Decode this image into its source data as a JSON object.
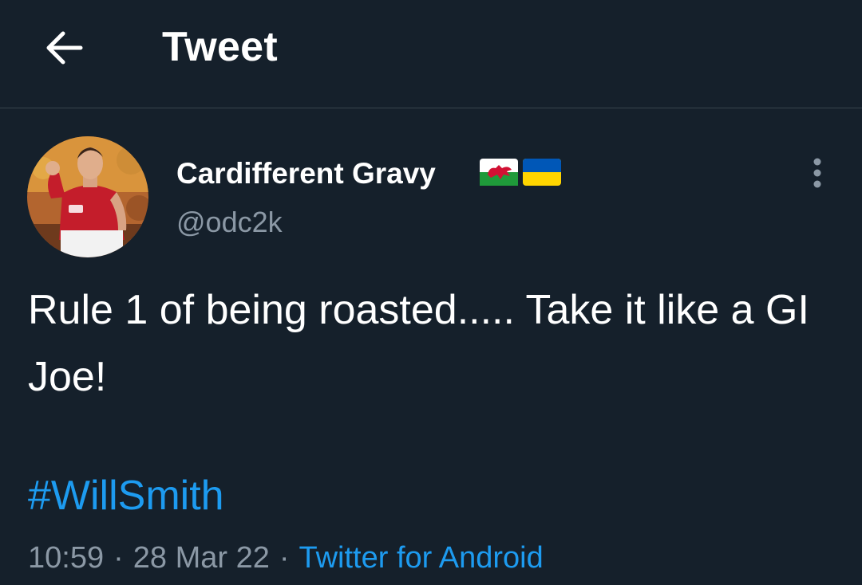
{
  "header": {
    "back_icon": "arrow-left-icon",
    "title": "Tweet"
  },
  "tweet": {
    "author": {
      "display_name": "Cardifferent Gravy",
      "handle": "@odc2k",
      "flags": [
        "wales-flag",
        "ukraine-flag"
      ]
    },
    "more_icon": "more-vertical-icon",
    "text": "Rule 1 of being roasted..... Take it like a GI Joe!",
    "hashtag": "#WillSmith",
    "time": "10:59",
    "separator": "·",
    "date": "28 Mar 22",
    "source": "Twitter for Android"
  },
  "colors": {
    "background": "#15202b",
    "divider": "#38444d",
    "text_primary": "#ffffff",
    "text_secondary": "#8b98a5",
    "accent": "#1d9bf0"
  }
}
